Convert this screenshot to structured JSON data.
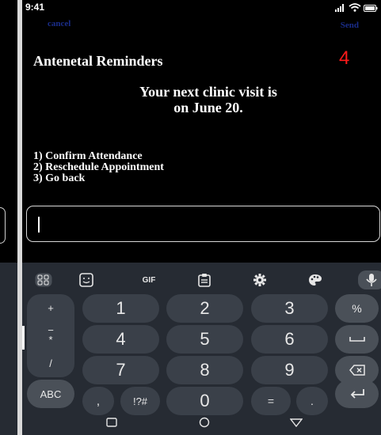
{
  "status_bar": {
    "time": "9:41",
    "signal_icon": "signal-icon",
    "wifi_icon": "wifi-icon",
    "battery_icon": "battery-icon"
  },
  "topbar": {
    "cancel_label": "cancel",
    "send_label": "Send"
  },
  "message": {
    "title": "Antenetal Reminders",
    "counter": "4",
    "body_line1": "Your next clinic visit is",
    "body_line2": "on June 20.",
    "options": [
      "1) Confirm Attendance",
      "2) Reschedule Appointment",
      "3) Go back"
    ]
  },
  "input": {
    "value": ""
  },
  "keyboard": {
    "toolbar_icons": [
      "grid-icon",
      "sticker-icon",
      "gif-icon",
      "clipboard-icon",
      "settings-icon",
      "palette-icon",
      "microphone-icon"
    ],
    "gif_label": "GIF",
    "rows": [
      [
        "+",
        "1",
        "2",
        "3",
        "%"
      ],
      [
        "−",
        "4",
        "5",
        "6",
        "␣"
      ],
      [
        "*",
        "7",
        "8",
        "9",
        "⌫"
      ],
      [
        "/",
        "0",
        "=",
        ".",
        "↵"
      ]
    ],
    "side_symbols": [
      "+",
      "−",
      "*",
      "/"
    ],
    "abc_label": "ABC",
    "comma_label": ",",
    "symbols_label": "!?#",
    "digits": [
      "1",
      "2",
      "3",
      "4",
      "5",
      "6",
      "7",
      "8",
      "9",
      "0"
    ],
    "percent_label": "%",
    "equals_label": "=",
    "period_label": "."
  },
  "colors": {
    "keyboard_bg": "#262b33",
    "key_bg": "#3a4049",
    "link": "#1a2d8a",
    "counter": "#ff1a1a"
  }
}
